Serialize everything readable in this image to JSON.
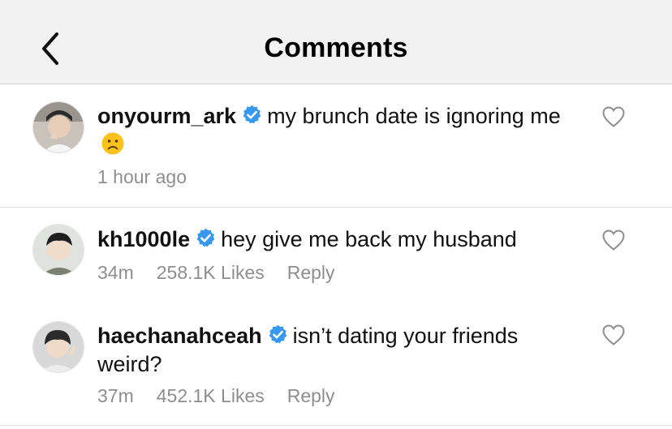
{
  "header": {
    "title": "Comments",
    "back_icon": "chevron-left-icon"
  },
  "colors": {
    "header_bg": "#f2f2f2",
    "meta_text": "#8e8e8e",
    "verified_badge": "#3897f0"
  },
  "comments": [
    {
      "username": "onyourm_ark",
      "verified": true,
      "text": "my brunch date is ignoring me",
      "emoji": "frowning-face",
      "time": "1 hour ago"
    },
    {
      "username": "kh1000le",
      "verified": true,
      "text": "hey give me back my husband",
      "time": "34m",
      "likes": "258.1K Likes",
      "reply": "Reply"
    },
    {
      "username": "haechanahceah",
      "verified": true,
      "text": "isn’t dating your friends weird?",
      "time": "37m",
      "likes": "452.1K Likes",
      "reply": "Reply"
    }
  ]
}
